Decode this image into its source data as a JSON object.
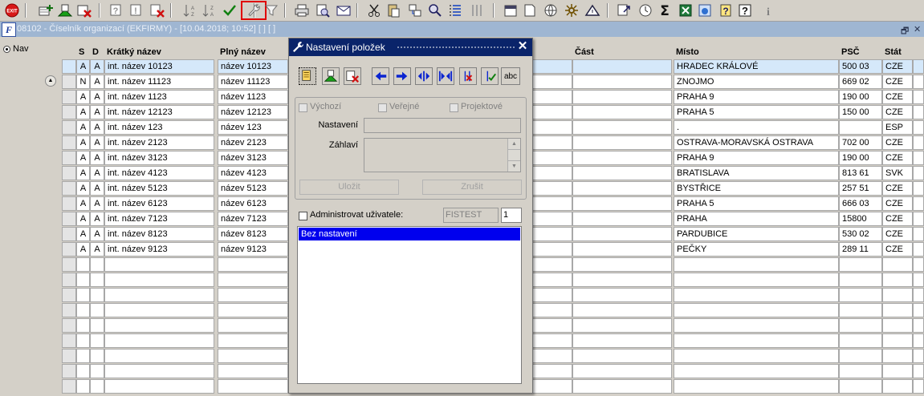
{
  "toolbar": {
    "icons": [
      "exit-icon",
      "add-row-icon",
      "copy-record-icon",
      "delete-record-icon",
      "query-icon",
      "query-run-icon",
      "query-clear-icon",
      "sort-asc-icon",
      "sort-desc-icon",
      "commit-icon",
      "item-settings-icon",
      "filter-icon",
      "print-icon",
      "print-preview-icon",
      "email-icon",
      "cut-icon",
      "paste-icon",
      "link-icon",
      "search-icon",
      "list-icon",
      "columns-icon",
      "calendar-icon",
      "document-icon",
      "globe-icon",
      "tools-icon",
      "alert-icon",
      "export-icon",
      "clock-icon",
      "sum-icon",
      "excel-icon",
      "browser-icon",
      "help-icon",
      "help-context-icon",
      "info-icon"
    ],
    "exit_label": "EXIT"
  },
  "window": {
    "app_icon": "F",
    "title": "08102 - Číselník organizací (EKFIRMY) - [10.04.2018; 10:52]  [ ]  [ ]",
    "restore": "🗗",
    "close": "✕"
  },
  "nav": {
    "label": "Nav"
  },
  "grid": {
    "headers": {
      "s": "S",
      "d": "D",
      "short": "Krátký název",
      "full": "Plný název",
      "part": "Část",
      "place": "Místo",
      "psc": "PSČ",
      "state": "Stát"
    },
    "rows": [
      {
        "s": "A",
        "d": "A",
        "short": "int. název 10123",
        "full": "název 10123",
        "place": "HRADEC KRÁLOVÉ",
        "psc": "500 03",
        "state": "CZE"
      },
      {
        "s": "N",
        "d": "A",
        "short": "int. název 11123",
        "full": "název 11123",
        "place": "ZNOJMO",
        "psc": "669 02",
        "state": "CZE"
      },
      {
        "s": "A",
        "d": "A",
        "short": "int. název 1123",
        "full": "název 1123",
        "place": "PRAHA 9",
        "psc": "190 00",
        "state": "CZE"
      },
      {
        "s": "A",
        "d": "A",
        "short": "int. název 12123",
        "full": "název 12123",
        "place": "PRAHA 5",
        "psc": "150 00",
        "state": "CZE"
      },
      {
        "s": "A",
        "d": "A",
        "short": "int. název 123",
        "full": "název 123",
        "place": ".",
        "psc": "",
        "state": "ESP"
      },
      {
        "s": "A",
        "d": "A",
        "short": "int. název 2123",
        "full": "název 2123",
        "place": "OSTRAVA-MORAVSKÁ OSTRAVA",
        "psc": "702 00",
        "state": "CZE"
      },
      {
        "s": "A",
        "d": "A",
        "short": "int. název 3123",
        "full": "název 3123",
        "place": "PRAHA 9",
        "psc": "190 00",
        "state": "CZE"
      },
      {
        "s": "A",
        "d": "A",
        "short": "int. název 4123",
        "full": "název 4123",
        "place": "BRATISLAVA",
        "psc": "813 61",
        "state": "SVK"
      },
      {
        "s": "A",
        "d": "A",
        "short": "int. název 5123",
        "full": "název 5123",
        "place": "BYSTŘICE",
        "psc": "257 51",
        "state": "CZE"
      },
      {
        "s": "A",
        "d": "A",
        "short": "int. název 6123",
        "full": "název 6123",
        "place": "PRAHA 5",
        "psc": "666 03",
        "state": "CZE"
      },
      {
        "s": "A",
        "d": "A",
        "short": "int. název 7123",
        "full": "název 7123",
        "place": "PRAHA",
        "psc": "15800",
        "state": "CZE"
      },
      {
        "s": "A",
        "d": "A",
        "short": "int. název 8123",
        "full": "název 8123",
        "place": "PARDUBICE",
        "psc": "530 02",
        "state": "CZE"
      },
      {
        "s": "A",
        "d": "A",
        "short": "int. název 9123",
        "full": "název 9123",
        "place": "PEČKY",
        "psc": "289 11",
        "state": "CZE"
      }
    ]
  },
  "dialog": {
    "title": "Nastavení položek",
    "close": "✕",
    "buttons": [
      "active-settings-icon",
      "add-settings-icon",
      "delete-settings-icon",
      "arrow-left-icon",
      "arrow-right-icon",
      "expand-icon",
      "collapse-icon",
      "remove-icon",
      "confirm-icon",
      "abc-icon"
    ],
    "abc": "abc",
    "checks": {
      "default": "Výchozí",
      "public": "Veřejné",
      "project": "Projektové"
    },
    "setting_label": "Nastavení",
    "header_label": "Záhlaví",
    "save": "Uložit",
    "cancel": "Zrušit",
    "admin_label": "Administrovat uživatele:",
    "user_value": "FISTEST",
    "user_number": "1",
    "list": [
      "Bez nastavení"
    ]
  },
  "colors": {
    "dialog_title": "#0a246a",
    "list_selection": "#0000ee",
    "selected_row": "#d5e8fa",
    "window_title": "#9fb6d2"
  }
}
